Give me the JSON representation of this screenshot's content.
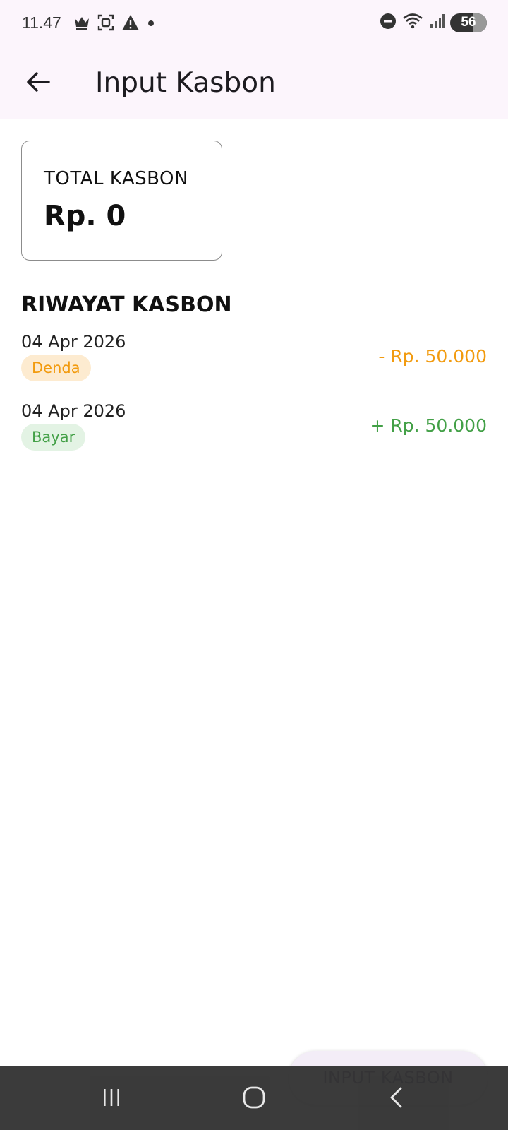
{
  "status_bar": {
    "time": "11.47",
    "battery": "56",
    "icons": [
      "crown-icon",
      "screenshot-icon",
      "warning-icon",
      "dot-icon",
      "dnd-icon",
      "wifi-icon",
      "signal-icon",
      "battery-icon"
    ]
  },
  "app_bar": {
    "title": "Input Kasbon",
    "back_icon": "arrow-left-icon"
  },
  "total": {
    "label": "TOTAL KASBON",
    "value": "Rp. 0"
  },
  "history": {
    "title": "RIWAYAT KASBON",
    "items": [
      {
        "date": "04 Apr 2026",
        "badge": "Denda",
        "amount": "- Rp. 50.000",
        "color": "#f29b0f",
        "badge_bg": "#fdebd0"
      },
      {
        "date": "04 Apr 2026",
        "badge": "Bayar",
        "amount": "+ Rp. 50.000",
        "color": "#43a047",
        "badge_bg": "#e3f3e4"
      }
    ]
  },
  "fab": {
    "label": "INPUT KASBON"
  },
  "colors": {
    "app_bar_bg": "#fcf5fc",
    "nav_bg": "#333333"
  }
}
